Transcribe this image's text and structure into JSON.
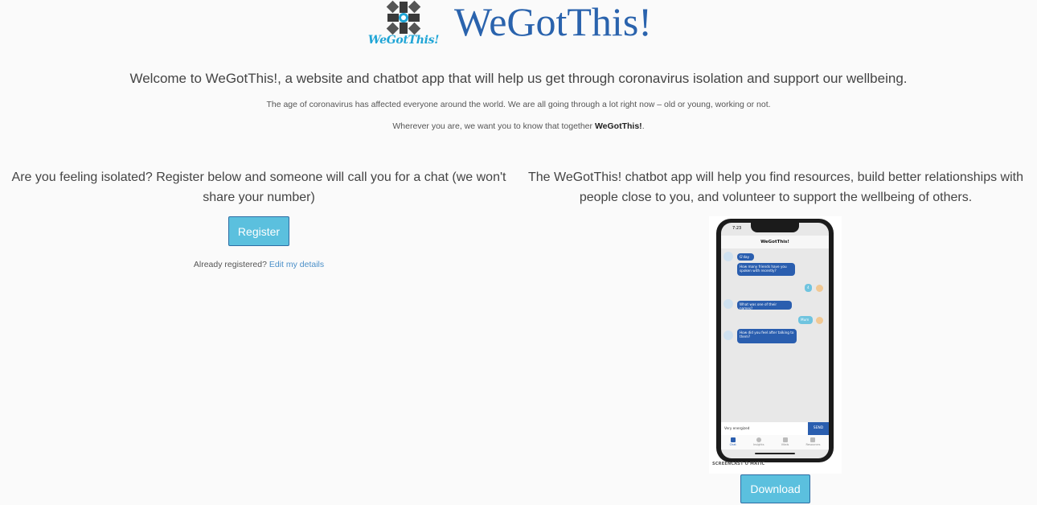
{
  "header": {
    "logo_text": "WeGotThis!",
    "title": "WeGotThis!"
  },
  "intro": {
    "welcome": "Welcome to WeGotThis!, a website and chatbot app that will help us get through coronavirus isolation and support our wellbeing.",
    "line1": "The age of coronavirus has affected everyone around the world. We are all going through a lot right now – old or young, working or not.",
    "line2_prefix": "Wherever you are, we want you to know that together ",
    "line2_brand": "WeGotThis!",
    "line2_suffix": "."
  },
  "left": {
    "text": "Are you feeling isolated? Register below and someone will call you for a chat (we won't share your number)",
    "register_label": "Register",
    "already_text": "Already registered? ",
    "edit_link": "Edit my details"
  },
  "right": {
    "text": "The WeGotThis! chatbot app will help you find resources, build better relationships with people close to you, and volunteer to support the wellbeing of others.",
    "download_label": "Download"
  },
  "phone": {
    "time": "7:23",
    "chat_title": "WeGotThis!",
    "messages": [
      {
        "from": "bot",
        "text": "G'day"
      },
      {
        "from": "bot",
        "text": "How many friends have you spoken with recently?"
      },
      {
        "from": "user",
        "text": "4"
      },
      {
        "from": "bot",
        "text": "What was one of their names?"
      },
      {
        "from": "user",
        "text": "Mum"
      },
      {
        "from": "bot",
        "text": "How did you feel after talking to them?"
      }
    ],
    "input_value": "Very energized",
    "send_label": "SEND",
    "tabs": [
      "Chat",
      "Insights",
      "Vitals",
      "Resources"
    ],
    "watermark": "SCREENCAST O MATIC"
  },
  "colors": {
    "brand_blue": "#2a63ad",
    "button_blue": "#5bc0de",
    "link_blue": "#4a8fc8"
  }
}
